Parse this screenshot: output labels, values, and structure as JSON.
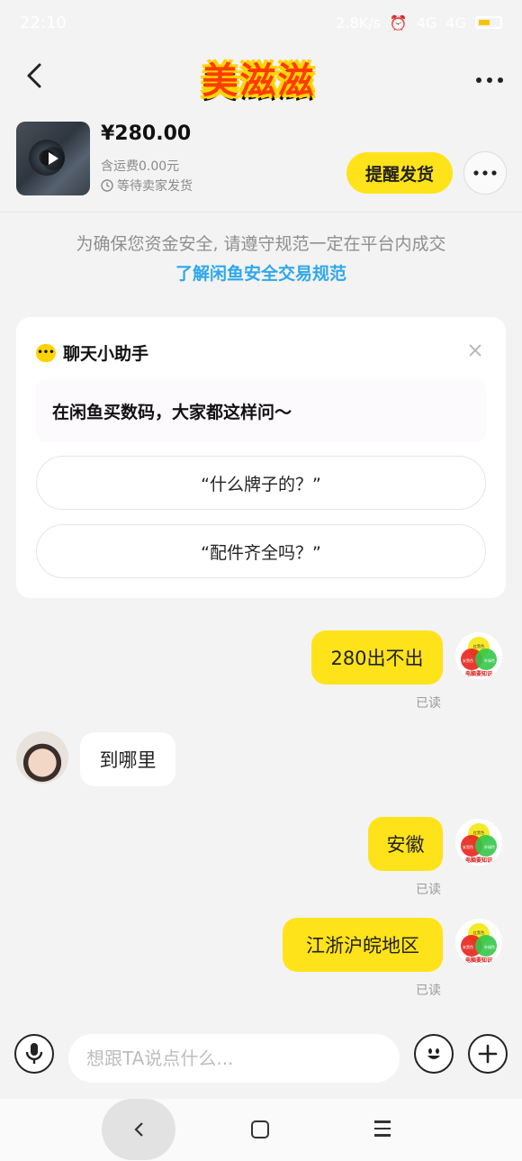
{
  "status_bar": {
    "time": "22:10",
    "net_speed": "2.8K/s",
    "signal_1": "4G",
    "signal_2": "4G",
    "battery": "65"
  },
  "header": {
    "logo_text": "美滋滋"
  },
  "product": {
    "price": "¥280.00",
    "shipping": "含运费0.00元",
    "status": "等待卖家发货",
    "remind_label": "提醒发货"
  },
  "notice": {
    "text": "为确保您资金安全, 请遵守规范一定在平台内成交",
    "link": "了解闲鱼安全交易规范"
  },
  "assistant": {
    "title": "聊天小助手",
    "tip": "在闲鱼买数码，大家都这样问～",
    "suggestions": [
      "“什么牌子的？”",
      "“配件齐全吗？”"
    ]
  },
  "messages": [
    {
      "side": "mine",
      "text": "280出不出",
      "read": "已读"
    },
    {
      "side": "theirs",
      "text": "到哪里"
    },
    {
      "side": "mine",
      "text": "安徽",
      "read": "已读"
    },
    {
      "side": "mine",
      "text": "江浙沪皖地区",
      "read": "已读"
    }
  ],
  "avatar_me": {
    "top": "红黑色",
    "left": "安黑色",
    "right": "外绿色",
    "caption": "电脑要知识"
  },
  "input": {
    "placeholder": "想跟TA说点什么..."
  },
  "colors": {
    "accent": "#ffe31a",
    "link": "#2fa8ea",
    "background": "#f3f3f3"
  },
  "icons": [
    "back-icon",
    "more-icon",
    "play-icon",
    "clock-icon",
    "chat-bubble-icon",
    "close-icon",
    "mic-icon",
    "emoji-icon",
    "plus-icon"
  ]
}
